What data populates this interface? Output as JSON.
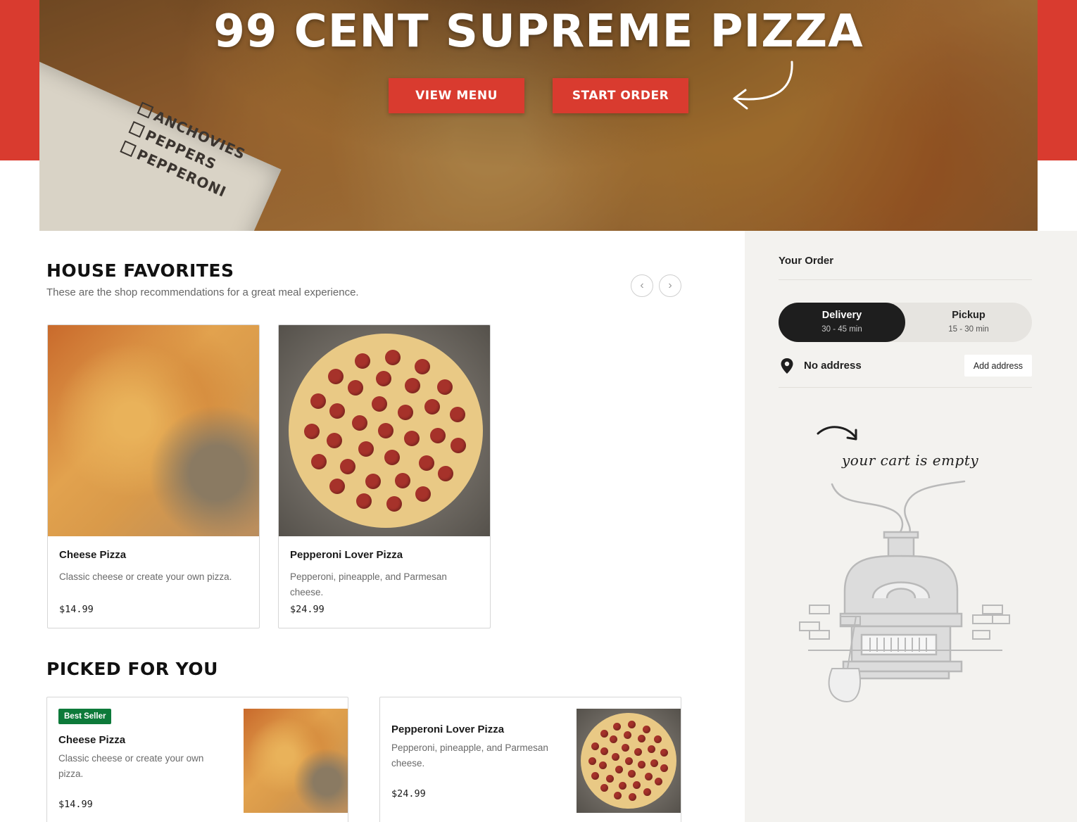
{
  "hero": {
    "title": "99 CENT SUPREME PIZZA",
    "view_menu_label": "VIEW MENU",
    "start_order_label": "START ORDER",
    "box_labels": [
      "ANCHOVIES",
      "PEPPERS",
      "PEPPERONI"
    ]
  },
  "house_favorites": {
    "title": "HOUSE FAVORITES",
    "subtitle": "These are the shop recommendations for a great meal experience.",
    "prev_label": "‹",
    "next_label": "›",
    "items": [
      {
        "name": "Cheese Pizza",
        "description": "Classic cheese or create your own pizza.",
        "price": "$14.99"
      },
      {
        "name": "Pepperoni Lover Pizza",
        "description": "Pepperoni, pineapple, and Parmesan cheese.",
        "price": "$24.99"
      }
    ]
  },
  "picked_for_you": {
    "title": "PICKED FOR YOU",
    "items": [
      {
        "badge": "Best Seller",
        "name": "Cheese Pizza",
        "description": "Classic cheese or create your own pizza.",
        "price": "$14.99"
      },
      {
        "name": "Pepperoni Lover Pizza",
        "description": "Pepperoni, pineapple, and Parmesan cheese.",
        "price": "$24.99"
      }
    ]
  },
  "order": {
    "title": "Your Order",
    "delivery": {
      "label": "Delivery",
      "time": "30 - 45 min"
    },
    "pickup": {
      "label": "Pickup",
      "time": "15 - 30 min"
    },
    "address_text": "No address",
    "add_address_label": "Add address",
    "empty_cart_text": "your cart is empty"
  },
  "colors": {
    "brand_red": "#d93b2f",
    "badge_green": "#0d7a3a",
    "sidebar_bg": "#f3f2ef",
    "toggle_active": "#1e1e1e"
  },
  "icons": [
    "curved-arrow-icon",
    "chevron-left-icon",
    "chevron-right-icon",
    "location-pin-icon",
    "pizza-oven-illustration"
  ]
}
